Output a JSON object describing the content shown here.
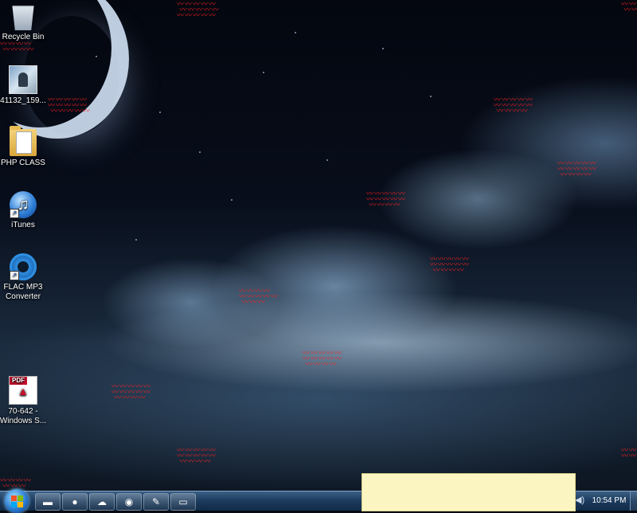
{
  "desktop": {
    "icons": [
      {
        "label": "Recycle Bin",
        "icon": "recycle-bin-icon"
      },
      {
        "label": "41132_159...",
        "icon": "image-file-icon"
      },
      {
        "label": "PHP CLASS",
        "icon": "folder-icon"
      },
      {
        "label": "iTunes",
        "icon": "itunes-icon"
      },
      {
        "label": "FLAC MP3 Converter",
        "icon": "gear-app-icon"
      },
      {
        "label": "70-642 - Windows S...",
        "icon": "pdf-file-icon"
      }
    ]
  },
  "taskbar": {
    "start_icon": "windows-start-icon",
    "pinned": [
      {
        "icon": "windows-explorer-icon"
      },
      {
        "icon": "firefox-icon"
      },
      {
        "icon": "messenger-icon"
      },
      {
        "icon": "network-app-icon"
      },
      {
        "icon": "notepad-icon"
      },
      {
        "icon": "sticky-notes-icon"
      }
    ],
    "clock": "10:54 PM"
  },
  "colors": {
    "taskbar": "#1b3a5c",
    "squiggle": "#ff2020",
    "popup": "#fbf6c1"
  }
}
